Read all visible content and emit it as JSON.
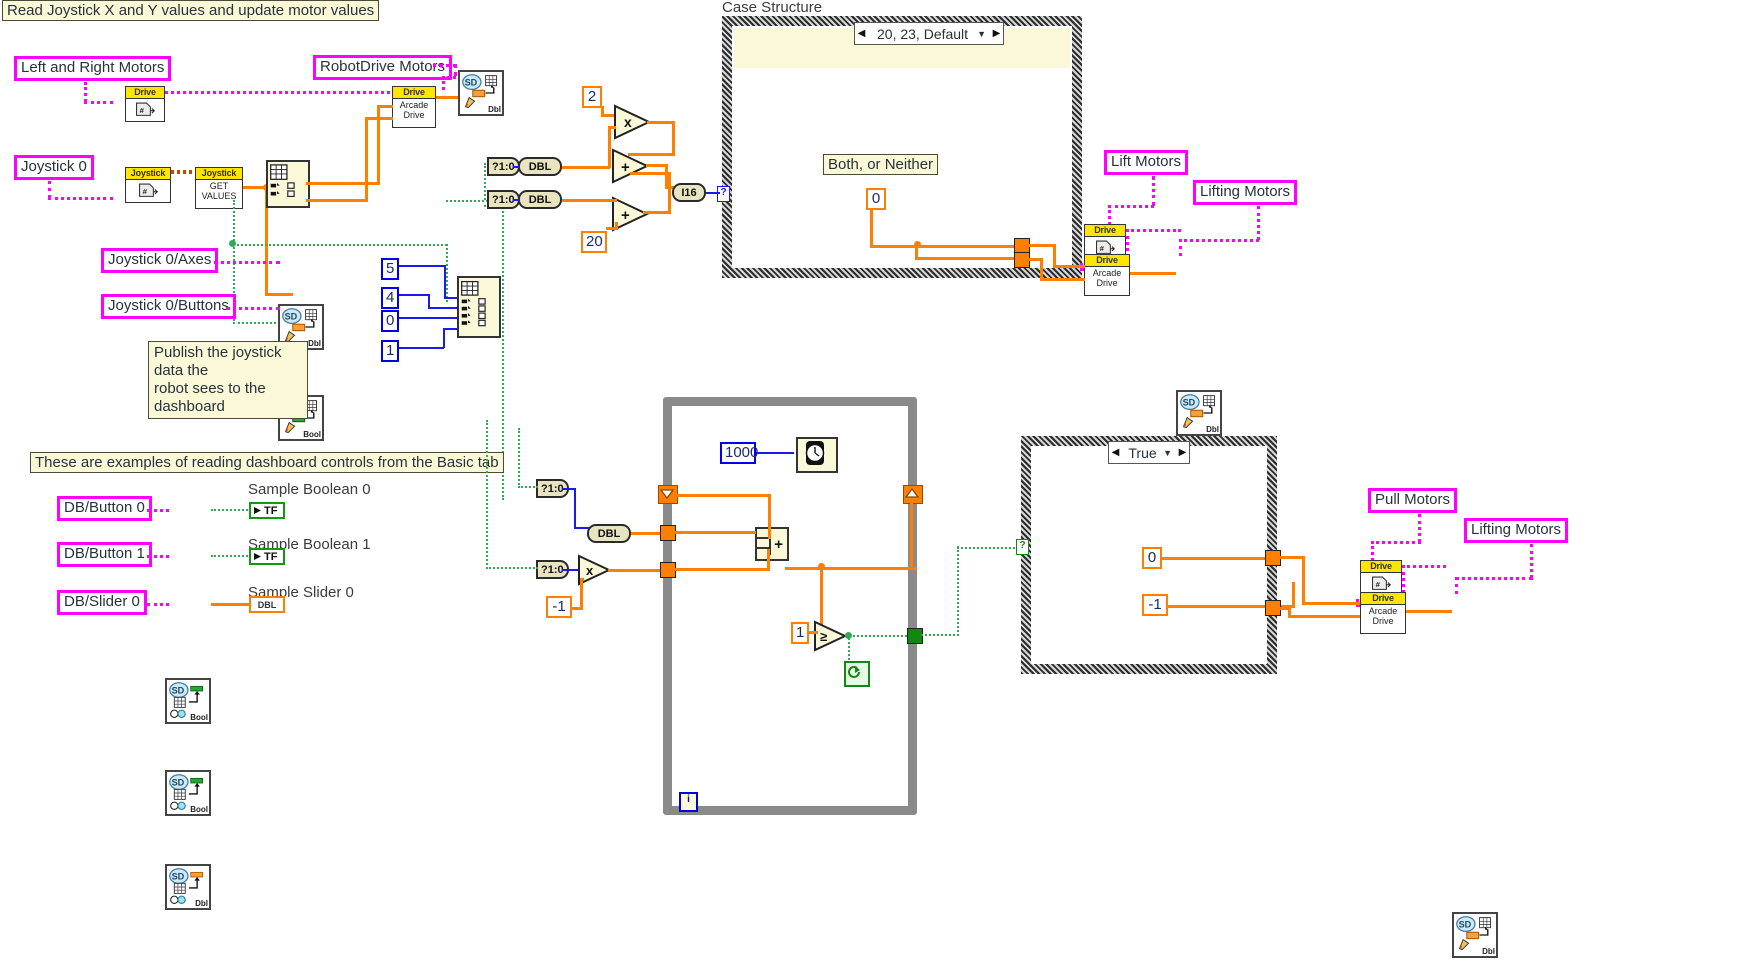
{
  "meta": {
    "accent_magenta": "#ff00ff",
    "accent_orange": "#ff7f00",
    "accent_green": "#33aa55",
    "accent_blue": "#1a1aee",
    "comment_bg": "#fbf8d8"
  },
  "comments": {
    "top": "Read Joystick X and Y values and update motor values",
    "publish": "Publish the joystick data the\nrobot sees to the dashboard",
    "dashboard_examples": "These are examples of reading dashboard controls from the Basic tab",
    "both_or_neither": "Both, or Neither"
  },
  "captions": {
    "case_structure": "Case Structure",
    "sample_boolean_0": "Sample Boolean 0",
    "sample_boolean_1": "Sample Boolean 1",
    "sample_slider_0": "Sample Slider 0"
  },
  "string_constants": [
    {
      "name": "left-and-right-motors",
      "value": "Left and Right Motors"
    },
    {
      "name": "robotdrive-motors",
      "value": "RobotDrive Motors"
    },
    {
      "name": "joystick-0",
      "value": "Joystick 0"
    },
    {
      "name": "joystick-0-axes",
      "value": "Joystick 0/Axes"
    },
    {
      "name": "joystick-0-buttons",
      "value": "Joystick 0/Buttons"
    },
    {
      "name": "lift-motors",
      "value": "Lift Motors"
    },
    {
      "name": "lifting-motors-top",
      "value": "Lifting Motors"
    },
    {
      "name": "db-button-0",
      "value": "DB/Button 0"
    },
    {
      "name": "db-button-1",
      "value": "DB/Button 1"
    },
    {
      "name": "db-slider-0",
      "value": "DB/Slider 0"
    },
    {
      "name": "pull-motors",
      "value": "Pull Motors"
    },
    {
      "name": "lifting-motors-bottom",
      "value": "Lifting Motors"
    }
  ],
  "numeric_constants": {
    "mul_two": "2",
    "add_twenty": "20",
    "case_zero": "0",
    "arr_5": "5",
    "arr_4": "4",
    "arr_0": "0",
    "arr_1": "1",
    "wait_ms": "1000",
    "neg_one_left": "-1",
    "greater_one": "1",
    "true_case_zero": "0",
    "true_case_neg_one": "-1"
  },
  "case_structures": [
    {
      "name": "numeric-case",
      "selector": "20, 23, Default"
    },
    {
      "name": "boolean-case",
      "selector": "True"
    }
  ],
  "subvis": [
    {
      "name": "drive-open-top",
      "header": "Drive",
      "body": ""
    },
    {
      "name": "arcade-drive-top",
      "header": "Drive",
      "body": "Arcade\nDrive"
    },
    {
      "name": "joystick-open",
      "header": "Joystick",
      "body": ""
    },
    {
      "name": "joystick-get-values",
      "header": "Joystick",
      "body": "GET\nVALUES"
    },
    {
      "name": "drive-open-lift",
      "header": "Drive",
      "body": ""
    },
    {
      "name": "arcade-drive-lift",
      "header": "Drive",
      "body": "Arcade\nDrive"
    },
    {
      "name": "drive-open-pull",
      "header": "Drive",
      "body": ""
    },
    {
      "name": "arcade-drive-pull",
      "header": "Drive",
      "body": "Arcade\nDrive"
    }
  ],
  "sd_nodes": [
    {
      "name": "sd-write-robotdrive",
      "type": "Dbl"
    },
    {
      "name": "sd-write-axes",
      "type": "Dbl"
    },
    {
      "name": "sd-write-buttons",
      "type": "Bool"
    },
    {
      "name": "sd-read-button-0",
      "type": "Bool"
    },
    {
      "name": "sd-read-button-1",
      "type": "Bool"
    },
    {
      "name": "sd-read-slider-0",
      "type": "Dbl"
    },
    {
      "name": "sd-write-lifting-top",
      "type": "Dbl"
    },
    {
      "name": "sd-write-lifting-bottom",
      "type": "Dbl"
    }
  ],
  "indicators": {
    "tf_0": "TF",
    "tf_1": "TF",
    "dbl_slider": "DBL"
  },
  "conversions": {
    "bool2num": "?1:0",
    "to_dbl": "DBL",
    "to_i16": "I16"
  },
  "primitives": {
    "multiply": "x",
    "add": "+",
    "greater_equal": "≥",
    "compound_add": "+"
  },
  "loop": {
    "name": "while-loop",
    "iteration_terminal": "i"
  }
}
